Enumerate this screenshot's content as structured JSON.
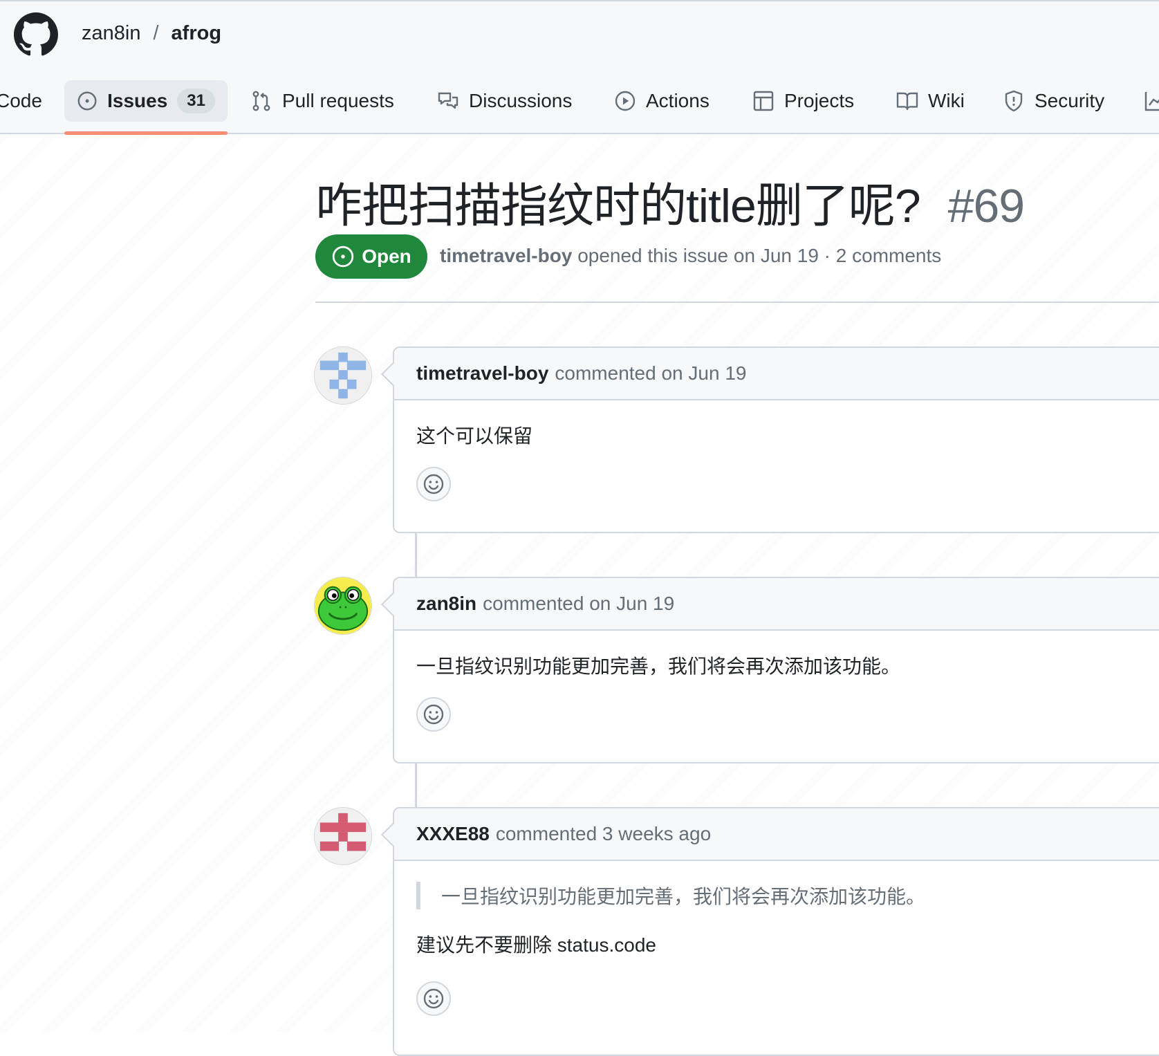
{
  "repo": {
    "owner": "zan8in",
    "separator": "/",
    "name": "afrog"
  },
  "tabs": [
    {
      "label": "Code",
      "icon": "code-icon"
    },
    {
      "label": "Issues",
      "icon": "issue-opened-icon",
      "count": "31"
    },
    {
      "label": "Pull requests",
      "icon": "git-pull-request-icon"
    },
    {
      "label": "Discussions",
      "icon": "comment-discussion-icon"
    },
    {
      "label": "Actions",
      "icon": "play-icon"
    },
    {
      "label": "Projects",
      "icon": "table-icon"
    },
    {
      "label": "Wiki",
      "icon": "book-icon"
    },
    {
      "label": "Security",
      "icon": "shield-icon"
    }
  ],
  "issue": {
    "title": "咋把扫描指纹时的title删了呢?",
    "number": "#69",
    "state": "Open",
    "author": "timetravel-boy",
    "opened_text": "opened this issue on Jun 19 · 2 comments"
  },
  "comments": [
    {
      "author": "timetravel-boy",
      "time": "commented on Jun 19",
      "body": "这个可以保留"
    },
    {
      "author": "zan8in",
      "time": "commented on Jun 19",
      "body": "一旦指纹识别功能更加完善，我们将会再次添加该功能。"
    },
    {
      "author": "XXXE88",
      "time": "commented 3 weeks ago",
      "quote": "一旦指纹识别功能更加完善，我们将会再次添加该功能。",
      "body": "建议先不要删除 status.code"
    }
  ],
  "colors": {
    "open_green": "#1f883d",
    "tab_underline": "#fd8c73",
    "border": "#d0d7de",
    "muted_text": "#656d76"
  }
}
